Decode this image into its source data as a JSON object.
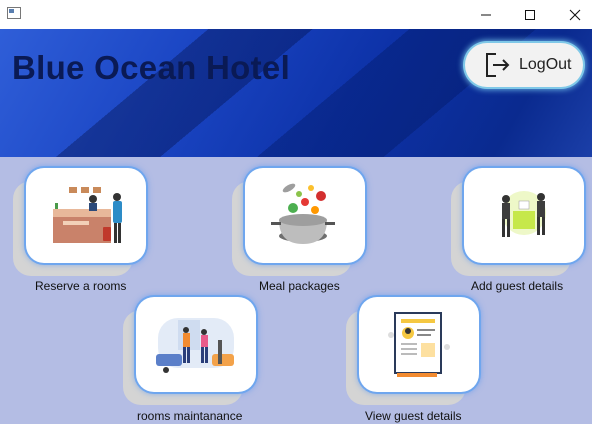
{
  "window": {
    "controls": [
      "minimize",
      "maximize",
      "close"
    ]
  },
  "header": {
    "title": "Blue Ocean Hotel",
    "logout_label": "LogOut"
  },
  "cards": [
    {
      "label": "Reserve a rooms",
      "icon": "hotel-reception-illustration"
    },
    {
      "label": "Meal packages",
      "icon": "cooking-pot-illustration"
    },
    {
      "label": "Add guest details",
      "icon": "guest-meeting-illustration"
    },
    {
      "label": "rooms maintanance",
      "icon": "room-cleaning-illustration"
    },
    {
      "label": "View guest details",
      "icon": "guest-profile-document-illustration"
    }
  ],
  "colors": {
    "header_blue": "#1b46c4",
    "title_text": "#0a1a55",
    "panel_background": "#b4bde4",
    "card_glow": "#6fa6ee"
  }
}
